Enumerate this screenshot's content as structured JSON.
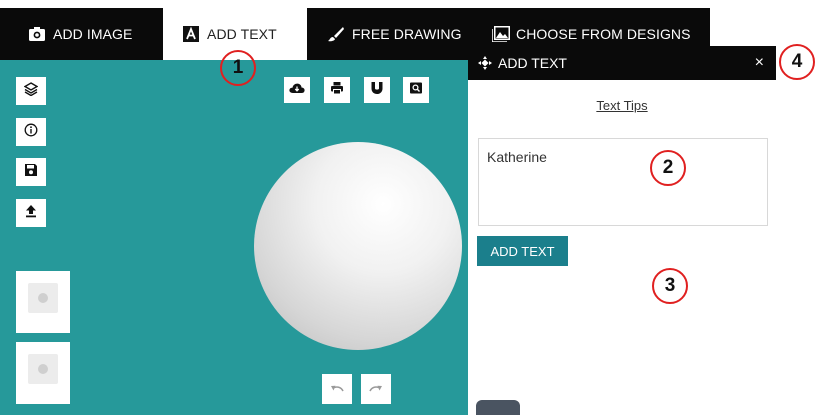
{
  "tabs": [
    {
      "label": "ADD IMAGE",
      "icon": "camera-icon"
    },
    {
      "label": "ADD TEXT",
      "icon": "text-a-icon"
    },
    {
      "label": "FREE DRAWING",
      "icon": "brush-icon"
    },
    {
      "label": "CHOOSE FROM DESIGNS",
      "icon": "image-gallery-icon"
    }
  ],
  "active_tab": "ADD TEXT",
  "panel": {
    "title": "ADD TEXT",
    "close_label": "×",
    "text_tips": "Text Tips",
    "text_value": "Katherine",
    "add_button": "ADD TEXT"
  },
  "canvas_tools": {
    "side": [
      "layers-icon",
      "info-icon",
      "save-icon",
      "upload-icon"
    ],
    "top": [
      "cloud-download-icon",
      "print-icon",
      "magnet-icon",
      "zoom-icon"
    ],
    "bottom": [
      "undo-icon",
      "redo-icon"
    ]
  },
  "markers": [
    "1",
    "2",
    "3",
    "4"
  ],
  "colors": {
    "canvas_bg": "#26999a",
    "tab_bar": "#0a0a0a",
    "accent_button": "#1b7f8c",
    "marker_ring": "#e02020"
  }
}
